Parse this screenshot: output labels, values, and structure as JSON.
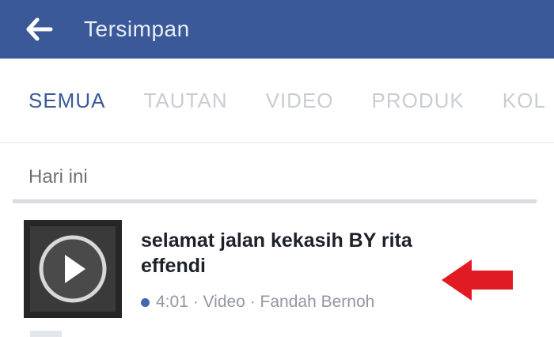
{
  "header": {
    "title": "Tersimpan",
    "back_icon": "arrow-left-icon",
    "color": "#3b5998"
  },
  "tabs": [
    {
      "label": "SEMUA",
      "active": true
    },
    {
      "label": "TAUTAN",
      "active": false
    },
    {
      "label": "VIDEO",
      "active": false
    },
    {
      "label": "PRODUK",
      "active": false
    },
    {
      "label": "KOL",
      "active": false
    }
  ],
  "section": {
    "label": "Hari ini"
  },
  "items": [
    {
      "title": "selamat jalan kekasih BY rita effendi",
      "meta": "4:01 · Video · Fandah Bernoh",
      "thumbnail_icon": "play-circle-icon",
      "status_dot_color": "#4267b2"
    }
  ],
  "annotation": {
    "icon": "red-arrow-left-icon",
    "color": "#e01b24"
  }
}
